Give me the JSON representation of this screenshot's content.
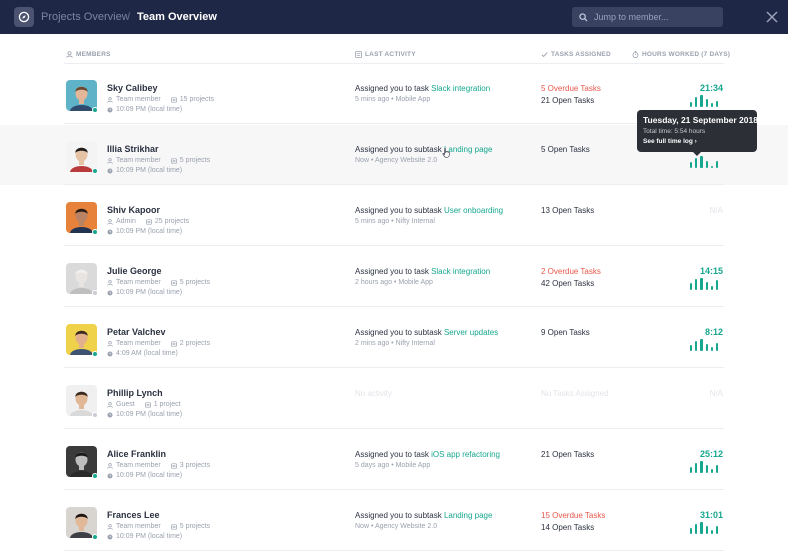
{
  "header": {
    "parent": "Projects Overview",
    "separator": "/",
    "title": "Team Overview",
    "search_placeholder": "Jump to member..."
  },
  "columns": {
    "members": "MEMBERS",
    "activity": "LAST ACTIVITY",
    "tasks": "TASKS ASSIGNED",
    "hours": "HOURS WORKED (7 DAYS)"
  },
  "colors": {
    "header_bg": "#1f2747",
    "accent": "#16a78e",
    "overdue": "#e8584c",
    "online": "#16a78e",
    "offline": "#c9ccd3"
  },
  "tooltip": {
    "date": "Tuesday, 21 September 2018",
    "total": "Total time: 5:54 hours",
    "link": "See full time log ›"
  },
  "members": [
    {
      "name": "Sky Calibey",
      "role": "Team member",
      "projects": "15 projects",
      "time": "10:09 PM (local time)",
      "status": "online",
      "activity": {
        "prefix": "Assigned you to task",
        "link": "Slack integration",
        "sub": "5 mins ago • Mobile App"
      },
      "overdue": "5 Overdue Tasks",
      "open": "21 Open Tasks",
      "hours": "21:34",
      "spark": [
        0.45,
        0.8,
        1.0,
        0.7,
        0.35,
        0.5
      ]
    },
    {
      "name": "Illia Strikhar",
      "role": "Team member",
      "projects": "5 projects",
      "time": "10:09 PM (local time)",
      "status": "online",
      "activity": {
        "prefix": "Assigned you to subtask",
        "link": "Landing page",
        "sub": "Now • Agency Website 2.0"
      },
      "overdue": "",
      "open": "5 Open Tasks",
      "hours": "",
      "spark": [
        0.5,
        0.85,
        1.0,
        0.6,
        0.2,
        0.6
      ]
    },
    {
      "name": "Shiv Kapoor",
      "role": "Admin",
      "projects": "25 projects",
      "time": "10:09 PM (local time)",
      "status": "online",
      "activity": {
        "prefix": "Assigned you to subtask",
        "link": "User onboarding",
        "sub": "5 mins ago • Nifty Internal"
      },
      "overdue": "",
      "open": "13 Open Tasks",
      "hours": "N/A",
      "spark": []
    },
    {
      "name": "Julie George",
      "role": "Team member",
      "projects": "5 projects",
      "time": "10:09 PM (local time)",
      "status": "offline",
      "activity": {
        "prefix": "Assigned you to task",
        "link": "Slack integration",
        "sub": "2 hours ago • Mobile App"
      },
      "overdue": "2 Overdue Tasks",
      "open": "42 Open Tasks",
      "hours": "14:15",
      "spark": [
        0.55,
        0.9,
        1.0,
        0.7,
        0.3,
        0.8
      ]
    },
    {
      "name": "Petar Valchev",
      "role": "Team member",
      "projects": "2 projects",
      "time": "4:09 AM (local time)",
      "status": "online",
      "activity": {
        "prefix": "Assigned you to subtask",
        "link": "Server updates",
        "sub": "2 mins ago • Nifty Internal"
      },
      "overdue": "",
      "open": "9 Open Tasks",
      "hours": "8:12",
      "spark": [
        0.5,
        0.85,
        1.0,
        0.6,
        0.3,
        0.65
      ]
    },
    {
      "name": "Phillip Lynch",
      "role": "Guest",
      "projects": "1 project",
      "time": "10:09 PM (local time)",
      "status": "offline",
      "activity": {
        "prefix": "",
        "link": "",
        "sub": "",
        "empty": "No activity"
      },
      "overdue": "",
      "open": "",
      "no_tasks": "No Tasks Assigned",
      "hours": "N/A",
      "spark": []
    },
    {
      "name": "Alice Franklin",
      "role": "Team member",
      "projects": "3 projects",
      "time": "10:09 PM (local time)",
      "status": "online",
      "activity": {
        "prefix": "Assigned you to task",
        "link": "iOS app refactoring",
        "sub": "5 days ago • Mobile App"
      },
      "overdue": "",
      "open": "21 Open Tasks",
      "hours": "25:12",
      "spark": [
        0.5,
        0.85,
        1.0,
        0.65,
        0.35,
        0.7
      ]
    },
    {
      "name": "Frances Lee",
      "role": "Team member",
      "projects": "5 projects",
      "time": "10:09 PM (local time)",
      "status": "online",
      "activity": {
        "prefix": "Assigned you to subtask",
        "link": "Landing page",
        "sub": "Now • Agency Website 2.0"
      },
      "overdue": "15 Overdue Tasks",
      "open": "14 Open Tasks",
      "hours": "31:01",
      "spark": [
        0.5,
        0.85,
        1.0,
        0.65,
        0.3,
        0.7
      ]
    }
  ],
  "avatars": [
    {
      "bg": "#5fb3c8",
      "skin": "#e2b697",
      "hair": "#6b4a33",
      "shirt": "#2f4b6e"
    },
    {
      "bg": "#f4f4f4",
      "skin": "#e7c3a6",
      "hair": "#1e1a18",
      "shirt": "#b83a3a"
    },
    {
      "bg": "#e6823a",
      "skin": "#b98363",
      "hair": "#2a1d16",
      "shirt": "#223352"
    },
    {
      "bg": "#dadada",
      "skin": "#e7e4e1",
      "hair": "#f2f0ee",
      "shirt": "#bfbfbf"
    },
    {
      "bg": "#efd14a",
      "skin": "#e2b08d",
      "hair": "#3b2a1e",
      "shirt": "#3e5272"
    },
    {
      "bg": "#f0f0f0",
      "skin": "#e0b896",
      "hair": "#3a2b20",
      "shirt": "#d9d9d9"
    },
    {
      "bg": "#3a3a3a",
      "skin": "#bdbdbd",
      "hair": "#1a1a1a",
      "shirt": "#2a2a2a"
    },
    {
      "bg": "#d8d4d0",
      "skin": "#e1b898",
      "hair": "#1c1614",
      "shirt": "#3f3f46"
    }
  ]
}
